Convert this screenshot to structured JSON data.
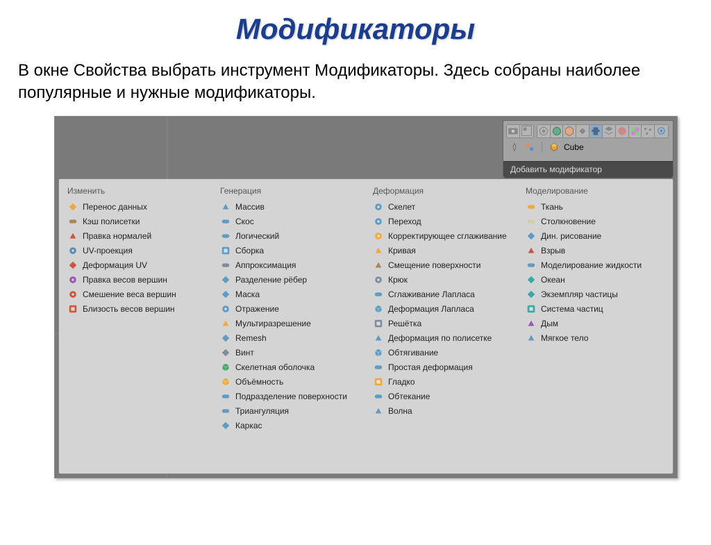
{
  "title": "Модификаторы",
  "description": "В окне Свойства выбрать инструмент Модификаторы. Здесь собраны наиболее популярные и нужные модификаторы.",
  "header": {
    "object_label": "Cube",
    "add_modifier": "Добавить модификатор"
  },
  "columns": [
    {
      "header": "Изменить",
      "items": [
        {
          "icon": "data-transfer",
          "label": "Перенос данных",
          "color": "#f5a020"
        },
        {
          "icon": "mesh-cache",
          "label": "Кэш полисетки",
          "color": "#a07850"
        },
        {
          "icon": "normals-edit",
          "label": "Правка нормалей",
          "color": "#c84020"
        },
        {
          "icon": "uv-project",
          "label": "UV-проекция",
          "color": "#4080b0"
        },
        {
          "icon": "uv-warp",
          "label": "Деформация UV",
          "color": "#c84020"
        },
        {
          "icon": "vert-weight-edit",
          "label": "Правка весов вершин",
          "color": "#8a40b0"
        },
        {
          "icon": "vert-weight-mix",
          "label": "Смешение веса вершин",
          "color": "#c84020"
        },
        {
          "icon": "vert-weight-prox",
          "label": "Близость весов вершин",
          "color": "#c84020"
        }
      ]
    },
    {
      "header": "Генерация",
      "items": [
        {
          "icon": "array",
          "label": "Массив",
          "color": "#4a90c0"
        },
        {
          "icon": "bevel",
          "label": "Скос",
          "color": "#4a90c0"
        },
        {
          "icon": "boolean",
          "label": "Логический",
          "color": "#4a90c0"
        },
        {
          "icon": "build",
          "label": "Сборка",
          "color": "#4a90c0"
        },
        {
          "icon": "decimate",
          "label": "Аппроксимация",
          "color": "#708090"
        },
        {
          "icon": "edge-split",
          "label": "Разделение рёбер",
          "color": "#4a90c0"
        },
        {
          "icon": "mask",
          "label": "Маска",
          "color": "#4a90c0"
        },
        {
          "icon": "mirror",
          "label": "Отражение",
          "color": "#4a90c0"
        },
        {
          "icon": "multires",
          "label": "Мультиразрешение",
          "color": "#f5a020"
        },
        {
          "icon": "remesh",
          "label": "Remesh",
          "color": "#4a90c0"
        },
        {
          "icon": "screw",
          "label": "Винт",
          "color": "#708090"
        },
        {
          "icon": "skin",
          "label": "Скелетная оболочка",
          "color": "#20a050"
        },
        {
          "icon": "solidify",
          "label": "Объёмность",
          "color": "#f5a020"
        },
        {
          "icon": "subsurf",
          "label": "Подразделение поверхности",
          "color": "#4a90c0"
        },
        {
          "icon": "triangulate",
          "label": "Триангуляция",
          "color": "#4a90c0"
        },
        {
          "icon": "wireframe",
          "label": "Каркас",
          "color": "#4a90c0"
        }
      ]
    },
    {
      "header": "Деформация",
      "items": [
        {
          "icon": "armature",
          "label": "Скелет",
          "color": "#4a90c0"
        },
        {
          "icon": "cast",
          "label": "Переход",
          "color": "#4a90c0"
        },
        {
          "icon": "corrective-smooth",
          "label": "Корректирующее сглаживание",
          "color": "#f5a020"
        },
        {
          "icon": "curve",
          "label": "Кривая",
          "color": "#f5a020"
        },
        {
          "icon": "displace",
          "label": "Смещение поверхности",
          "color": "#a07850"
        },
        {
          "icon": "hook",
          "label": "Крюк",
          "color": "#708090"
        },
        {
          "icon": "laplacian-smooth",
          "label": "Сглаживание Лапласа",
          "color": "#4a90c0"
        },
        {
          "icon": "laplacian-deform",
          "label": "Деформация Лапласа",
          "color": "#4a90c0"
        },
        {
          "icon": "lattice",
          "label": "Решётка",
          "color": "#708090"
        },
        {
          "icon": "mesh-deform",
          "label": "Деформация по полисетке",
          "color": "#4a90c0"
        },
        {
          "icon": "shrinkwrap",
          "label": "Обтягивание",
          "color": "#4a90c0"
        },
        {
          "icon": "simple-deform",
          "label": "Простая деформация",
          "color": "#4a90c0"
        },
        {
          "icon": "smooth",
          "label": "Гладко",
          "color": "#f5a020"
        },
        {
          "icon": "warp",
          "label": "Обтекание",
          "color": "#4a90c0"
        },
        {
          "icon": "wave",
          "label": "Волна",
          "color": "#4a90c0"
        }
      ]
    },
    {
      "header": "Моделирование",
      "items": [
        {
          "icon": "cloth",
          "label": "Ткань",
          "color": "#f5a020"
        },
        {
          "icon": "collision",
          "label": "Столкновение",
          "color": "#d0d0a0"
        },
        {
          "icon": "dynamic-paint",
          "label": "Дин. рисование",
          "color": "#4a90c0"
        },
        {
          "icon": "explode",
          "label": "Взрыв",
          "color": "#c84020"
        },
        {
          "icon": "fluid",
          "label": "Моделирование жидкости",
          "color": "#4a90c0"
        },
        {
          "icon": "ocean",
          "label": "Океан",
          "color": "#20a0a0"
        },
        {
          "icon": "particle-instance",
          "label": "Экземпляр частицы",
          "color": "#20a0a0"
        },
        {
          "icon": "particle-system",
          "label": "Система частиц",
          "color": "#20a0a0"
        },
        {
          "icon": "smoke",
          "label": "Дым",
          "color": "#8a40b0"
        },
        {
          "icon": "soft-body",
          "label": "Мягкое тело",
          "color": "#4a90c0"
        }
      ]
    }
  ]
}
